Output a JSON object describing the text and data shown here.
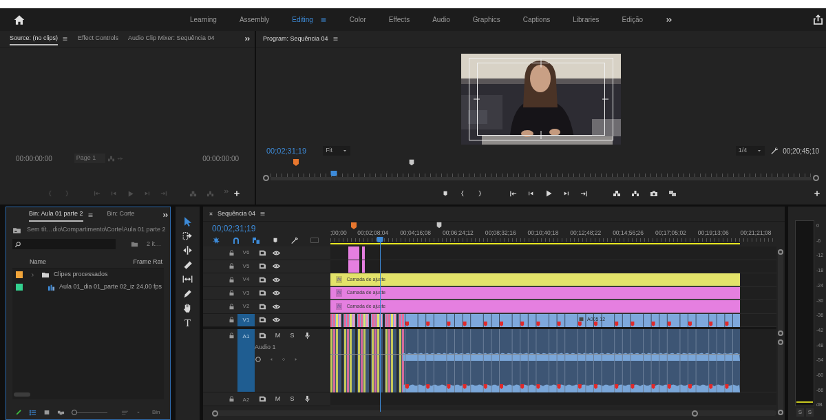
{
  "workspaces": [
    {
      "label": "Learning",
      "selected": false
    },
    {
      "label": "Assembly",
      "selected": false
    },
    {
      "label": "Editing",
      "selected": true
    },
    {
      "label": "Color",
      "selected": false
    },
    {
      "label": "Effects",
      "selected": false
    },
    {
      "label": "Audio",
      "selected": false
    },
    {
      "label": "Graphics",
      "selected": false
    },
    {
      "label": "Captions",
      "selected": false
    },
    {
      "label": "Libraries",
      "selected": false
    },
    {
      "label": "Edição",
      "selected": false
    }
  ],
  "source_panel": {
    "tabs": [
      {
        "label": "Source: (no clips)",
        "selected": true
      },
      {
        "label": "Effect Controls",
        "selected": false
      },
      {
        "label": "Audio Clip Mixer: Sequência 04",
        "selected": false
      }
    ],
    "timecode_in": "00:00:00:00",
    "page_dropdown": "Page 1",
    "timecode_out": "00:00:00:00"
  },
  "program_panel": {
    "title": "Program: Sequência 04",
    "timecode": "00;02;31;19",
    "zoom": "Fit",
    "resolution": "1/4",
    "duration": "00;20;45;10",
    "playhead": {
      "level": 0.117
    }
  },
  "project_panel": {
    "tabs": [
      {
        "label": "Bin: Aula 01 parte 2",
        "selected": true
      },
      {
        "label": "Bin: Corte",
        "selected": false
      }
    ],
    "path": "Sem tít…dio\\Compartimento\\Corte\\Aula 01 parte 2",
    "item_count": "2 it…",
    "columns": [
      "Name",
      "Frame Rat"
    ],
    "items": [
      {
        "kind": "folder",
        "name": "Clipes processados",
        "color": "#f0a43a"
      },
      {
        "kind": "sequence",
        "name": "Aula 01_dia 01_parte 02_iz",
        "frame_rate": "24,00 fps",
        "color": "#33d18f"
      }
    ],
    "zoom_slider": {
      "level": 0.0
    },
    "footer_label": "Bin"
  },
  "tools": [
    {
      "kind": "selection",
      "selected": true
    },
    {
      "kind": "track-select",
      "selected": false
    },
    {
      "kind": "ripple",
      "selected": false
    },
    {
      "kind": "razor",
      "selected": false
    },
    {
      "kind": "slip",
      "selected": false
    },
    {
      "kind": "pen",
      "selected": false
    },
    {
      "kind": "hand",
      "selected": false
    },
    {
      "kind": "type",
      "label": "T",
      "selected": false
    }
  ],
  "timeline": {
    "title": "Sequência 04",
    "timecode": "00;02;31;19",
    "ruler": [
      ";00;00",
      "00;02;08;04",
      "00;04;16;08",
      "00;06;24;12",
      "00;08;32;16",
      "00;10;40;18",
      "00;12;48;22",
      "00;14;56;26",
      "00;17;05;02",
      "00;19;13;06",
      "00;21;21;08"
    ],
    "playhead": {
      "level": 0.111
    },
    "video_tracks": [
      {
        "label": "V6",
        "targeted": false,
        "clips": [
          {
            "kind": "short",
            "color": "#e57fe0"
          }
        ]
      },
      {
        "label": "V5",
        "targeted": false,
        "clips": [
          {
            "kind": "short",
            "color": "#e57fe0"
          }
        ]
      },
      {
        "label": "V4",
        "targeted": false,
        "clips": [
          {
            "kind": "adjustment",
            "badge": "fx",
            "label": "Camada de ajuste",
            "color": "#e3e36a"
          }
        ]
      },
      {
        "label": "V3",
        "targeted": false,
        "clips": [
          {
            "kind": "adjustment",
            "badge": "fx",
            "label": "Camada de ajuste",
            "color": "#e57fe0"
          }
        ]
      },
      {
        "label": "V2",
        "targeted": false,
        "clips": [
          {
            "kind": "adjustment",
            "badge": "fx",
            "label": "Camada de ajuste",
            "color": "#e57fe0"
          }
        ]
      },
      {
        "label": "V1",
        "targeted": true,
        "clips": [
          {
            "kind": "footage",
            "label": "A005 12",
            "color": "#7ea8dc"
          }
        ]
      }
    ],
    "audio_tracks": [
      {
        "label": "A1",
        "targeted": true,
        "expanded": true,
        "name": "Audio 1",
        "buttons": [
          "M",
          "S"
        ]
      },
      {
        "label": "A2",
        "targeted": false,
        "expanded": false,
        "buttons": [
          "M",
          "S"
        ]
      }
    ]
  },
  "meter": {
    "scale": [
      "0",
      "-6",
      "-12",
      "-18",
      "-24",
      "-30",
      "-36",
      "-42",
      "-48",
      "-54",
      "-60",
      "-66",
      "dB"
    ],
    "solo_buttons": [
      "S",
      "S"
    ]
  }
}
